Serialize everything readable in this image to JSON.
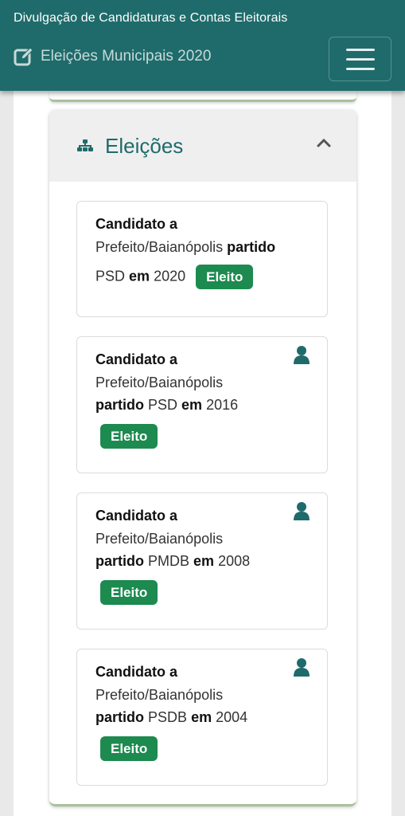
{
  "header": {
    "site_title": "Divulgação de Candidaturas e Contas Eleitorais",
    "subtitle": "Eleições Municipais 2020",
    "menu_icon": "hamburger-menu-icon"
  },
  "section": {
    "title": "Eleições",
    "icon": "sitemap-icon",
    "toggle_icon": "chevron-up-icon"
  },
  "entries": [
    {
      "cand": "Candidato a",
      "cargo": "Prefeito/Baianópolis",
      "partido_label": "partido",
      "partido": "PSD",
      "em_label": "em",
      "ano": "2020",
      "status": "Eleito"
    },
    {
      "cand": "Candidato a",
      "cargo": "Prefeito/Baianópolis",
      "partido_label": "partido",
      "partido": "PSD",
      "em_label": "em",
      "ano": "2016",
      "status": "Eleito"
    },
    {
      "cand": "Candidato a",
      "cargo": "Prefeito/Baianópolis",
      "partido_label": "partido",
      "partido": "PMDB",
      "em_label": "em",
      "ano": "2008",
      "status": "Eleito"
    },
    {
      "cand": "Candidato a",
      "cargo": "Prefeito/Baianópolis",
      "partido_label": "partido",
      "partido": "PSDB",
      "em_label": "em",
      "ano": "2004",
      "status": "Eleito"
    }
  ],
  "colors": {
    "header_bg": "#1f6b6b",
    "accent": "#1f6b6b",
    "badge_bg": "#1d8a4f"
  }
}
